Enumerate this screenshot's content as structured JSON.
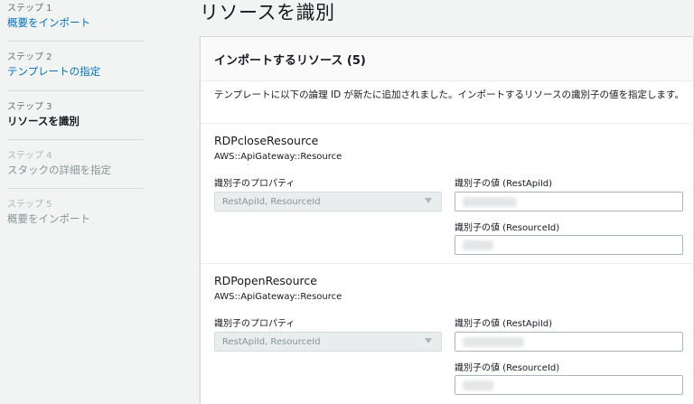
{
  "sidebar": {
    "steps": [
      {
        "num": "ステップ 1",
        "label": "概要をインポート",
        "state": "link"
      },
      {
        "num": "ステップ 2",
        "label": "テンプレートの指定",
        "state": "link"
      },
      {
        "num": "ステップ 3",
        "label": "リソースを識別",
        "state": "current"
      },
      {
        "num": "ステップ 4",
        "label": "スタックの詳細を指定",
        "state": "disabled"
      },
      {
        "num": "ステップ 5",
        "label": "概要をインポート",
        "state": "disabled"
      }
    ]
  },
  "page_title": "リソースを識別",
  "panel": {
    "title": "インポートするリソース (5)",
    "description": "テンプレートに以下の論理 ID が新たに追加されました。インポートするリソースの識別子の値を指定します。",
    "resources": [
      {
        "name": "RDPcloseResource",
        "type": "AWS::ApiGateway::Resource",
        "property_label": "識別子のプロパティ",
        "property_value": "RestApiId, ResourceId",
        "field1_label": "識別子の値 (RestApiId)",
        "field2_label": "識別子の値 (ResourceId)"
      },
      {
        "name": "RDPopenResource",
        "type": "AWS::ApiGateway::Resource",
        "property_label": "識別子のプロパティ",
        "property_value": "RestApiId, ResourceId",
        "field1_label": "識別子の値 (RestApiId)",
        "field2_label": "識別子の値 (ResourceId)"
      }
    ]
  },
  "colors": {
    "link": "#0073bb",
    "background": "#f2f3f3",
    "panel_header": "#fafafa"
  }
}
